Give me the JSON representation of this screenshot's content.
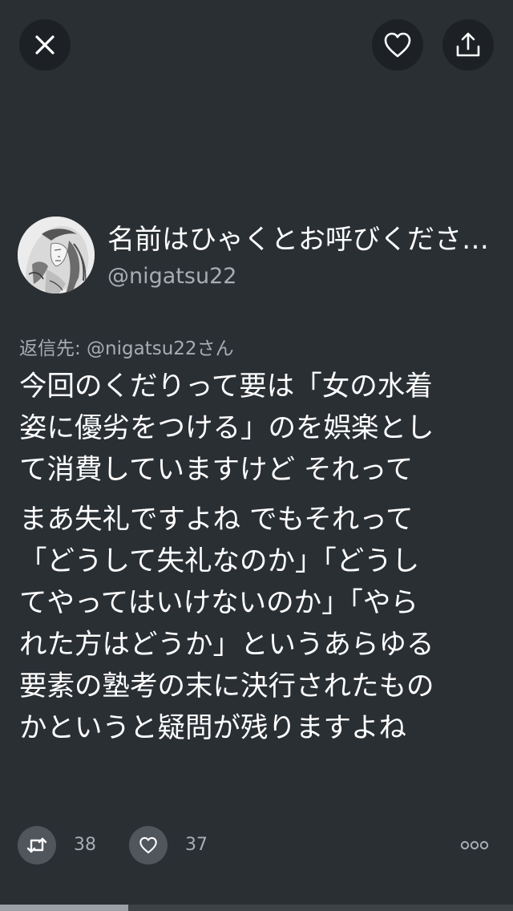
{
  "top_bar": {
    "close_icon": "close-icon",
    "like_icon": "heart-outline-icon",
    "share_icon": "share-upload-icon"
  },
  "author": {
    "display_name": "名前はひゃくとお呼びくださいませ",
    "handle": "@nigatsu22"
  },
  "reply_to": "返信先: @nigatsu22さん",
  "tweet": {
    "lines_group1": [
      "今回のくだりって要は「女の水着",
      "姿に優劣をつける」のを娯楽とし",
      "て消費していますけど  それって"
    ],
    "lines_group2": [
      "まあ失礼ですよね でもそれって",
      "「どうして失礼なのか」「どうし",
      "てやってはいけないのか」「やら",
      "れた方はどうか」というあらゆる",
      "要素の塾考の末に決行されたもの",
      "かというと疑問が残りますよね"
    ]
  },
  "actions": {
    "retweet_count": "38",
    "like_count": "37",
    "retweet_icon": "retweet-icon",
    "like_icon": "heart-outline-icon",
    "more_icon": "more-dots-icon"
  },
  "progress": {
    "fraction": 0.25
  },
  "colors": {
    "background": "#2a2f34",
    "button_dark": "#1d2125",
    "button_grey": "#50565c",
    "secondary_text": "#a7adb3"
  }
}
